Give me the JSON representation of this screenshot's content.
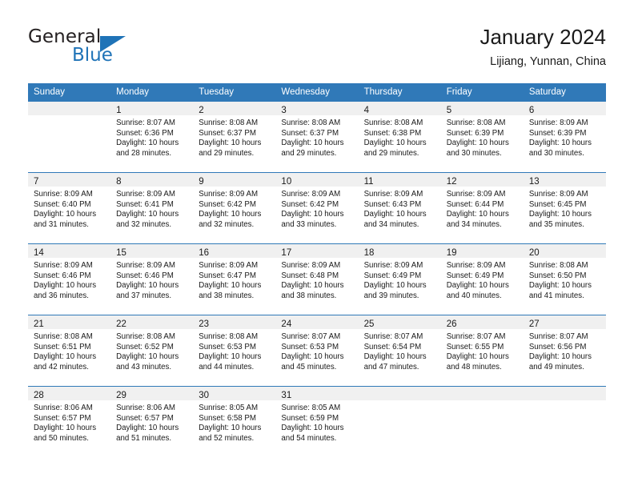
{
  "brand": {
    "name_part1": "General",
    "name_part2": "Blue",
    "accent_color": "#1f73b7"
  },
  "header": {
    "title": "January 2024",
    "subtitle": "Lijiang, Yunnan, China"
  },
  "theme": {
    "header_row_color": "#3079b8",
    "daynum_band_color": "#f0f0f0",
    "cell_background": "#ffffff",
    "separator_color": "#3079b8"
  },
  "weekday_headers": [
    "Sunday",
    "Monday",
    "Tuesday",
    "Wednesday",
    "Thursday",
    "Friday",
    "Saturday"
  ],
  "weeks": [
    [
      {
        "day": "",
        "sunrise": "",
        "sunset": "",
        "daylight1": "",
        "daylight2": ""
      },
      {
        "day": "1",
        "sunrise": "Sunrise: 8:07 AM",
        "sunset": "Sunset: 6:36 PM",
        "daylight1": "Daylight: 10 hours",
        "daylight2": "and 28 minutes."
      },
      {
        "day": "2",
        "sunrise": "Sunrise: 8:08 AM",
        "sunset": "Sunset: 6:37 PM",
        "daylight1": "Daylight: 10 hours",
        "daylight2": "and 29 minutes."
      },
      {
        "day": "3",
        "sunrise": "Sunrise: 8:08 AM",
        "sunset": "Sunset: 6:37 PM",
        "daylight1": "Daylight: 10 hours",
        "daylight2": "and 29 minutes."
      },
      {
        "day": "4",
        "sunrise": "Sunrise: 8:08 AM",
        "sunset": "Sunset: 6:38 PM",
        "daylight1": "Daylight: 10 hours",
        "daylight2": "and 29 minutes."
      },
      {
        "day": "5",
        "sunrise": "Sunrise: 8:08 AM",
        "sunset": "Sunset: 6:39 PM",
        "daylight1": "Daylight: 10 hours",
        "daylight2": "and 30 minutes."
      },
      {
        "day": "6",
        "sunrise": "Sunrise: 8:09 AM",
        "sunset": "Sunset: 6:39 PM",
        "daylight1": "Daylight: 10 hours",
        "daylight2": "and 30 minutes."
      }
    ],
    [
      {
        "day": "7",
        "sunrise": "Sunrise: 8:09 AM",
        "sunset": "Sunset: 6:40 PM",
        "daylight1": "Daylight: 10 hours",
        "daylight2": "and 31 minutes."
      },
      {
        "day": "8",
        "sunrise": "Sunrise: 8:09 AM",
        "sunset": "Sunset: 6:41 PM",
        "daylight1": "Daylight: 10 hours",
        "daylight2": "and 32 minutes."
      },
      {
        "day": "9",
        "sunrise": "Sunrise: 8:09 AM",
        "sunset": "Sunset: 6:42 PM",
        "daylight1": "Daylight: 10 hours",
        "daylight2": "and 32 minutes."
      },
      {
        "day": "10",
        "sunrise": "Sunrise: 8:09 AM",
        "sunset": "Sunset: 6:42 PM",
        "daylight1": "Daylight: 10 hours",
        "daylight2": "and 33 minutes."
      },
      {
        "day": "11",
        "sunrise": "Sunrise: 8:09 AM",
        "sunset": "Sunset: 6:43 PM",
        "daylight1": "Daylight: 10 hours",
        "daylight2": "and 34 minutes."
      },
      {
        "day": "12",
        "sunrise": "Sunrise: 8:09 AM",
        "sunset": "Sunset: 6:44 PM",
        "daylight1": "Daylight: 10 hours",
        "daylight2": "and 34 minutes."
      },
      {
        "day": "13",
        "sunrise": "Sunrise: 8:09 AM",
        "sunset": "Sunset: 6:45 PM",
        "daylight1": "Daylight: 10 hours",
        "daylight2": "and 35 minutes."
      }
    ],
    [
      {
        "day": "14",
        "sunrise": "Sunrise: 8:09 AM",
        "sunset": "Sunset: 6:46 PM",
        "daylight1": "Daylight: 10 hours",
        "daylight2": "and 36 minutes."
      },
      {
        "day": "15",
        "sunrise": "Sunrise: 8:09 AM",
        "sunset": "Sunset: 6:46 PM",
        "daylight1": "Daylight: 10 hours",
        "daylight2": "and 37 minutes."
      },
      {
        "day": "16",
        "sunrise": "Sunrise: 8:09 AM",
        "sunset": "Sunset: 6:47 PM",
        "daylight1": "Daylight: 10 hours",
        "daylight2": "and 38 minutes."
      },
      {
        "day": "17",
        "sunrise": "Sunrise: 8:09 AM",
        "sunset": "Sunset: 6:48 PM",
        "daylight1": "Daylight: 10 hours",
        "daylight2": "and 38 minutes."
      },
      {
        "day": "18",
        "sunrise": "Sunrise: 8:09 AM",
        "sunset": "Sunset: 6:49 PM",
        "daylight1": "Daylight: 10 hours",
        "daylight2": "and 39 minutes."
      },
      {
        "day": "19",
        "sunrise": "Sunrise: 8:09 AM",
        "sunset": "Sunset: 6:49 PM",
        "daylight1": "Daylight: 10 hours",
        "daylight2": "and 40 minutes."
      },
      {
        "day": "20",
        "sunrise": "Sunrise: 8:08 AM",
        "sunset": "Sunset: 6:50 PM",
        "daylight1": "Daylight: 10 hours",
        "daylight2": "and 41 minutes."
      }
    ],
    [
      {
        "day": "21",
        "sunrise": "Sunrise: 8:08 AM",
        "sunset": "Sunset: 6:51 PM",
        "daylight1": "Daylight: 10 hours",
        "daylight2": "and 42 minutes."
      },
      {
        "day": "22",
        "sunrise": "Sunrise: 8:08 AM",
        "sunset": "Sunset: 6:52 PM",
        "daylight1": "Daylight: 10 hours",
        "daylight2": "and 43 minutes."
      },
      {
        "day": "23",
        "sunrise": "Sunrise: 8:08 AM",
        "sunset": "Sunset: 6:53 PM",
        "daylight1": "Daylight: 10 hours",
        "daylight2": "and 44 minutes."
      },
      {
        "day": "24",
        "sunrise": "Sunrise: 8:07 AM",
        "sunset": "Sunset: 6:53 PM",
        "daylight1": "Daylight: 10 hours",
        "daylight2": "and 45 minutes."
      },
      {
        "day": "25",
        "sunrise": "Sunrise: 8:07 AM",
        "sunset": "Sunset: 6:54 PM",
        "daylight1": "Daylight: 10 hours",
        "daylight2": "and 47 minutes."
      },
      {
        "day": "26",
        "sunrise": "Sunrise: 8:07 AM",
        "sunset": "Sunset: 6:55 PM",
        "daylight1": "Daylight: 10 hours",
        "daylight2": "and 48 minutes."
      },
      {
        "day": "27",
        "sunrise": "Sunrise: 8:07 AM",
        "sunset": "Sunset: 6:56 PM",
        "daylight1": "Daylight: 10 hours",
        "daylight2": "and 49 minutes."
      }
    ],
    [
      {
        "day": "28",
        "sunrise": "Sunrise: 8:06 AM",
        "sunset": "Sunset: 6:57 PM",
        "daylight1": "Daylight: 10 hours",
        "daylight2": "and 50 minutes."
      },
      {
        "day": "29",
        "sunrise": "Sunrise: 8:06 AM",
        "sunset": "Sunset: 6:57 PM",
        "daylight1": "Daylight: 10 hours",
        "daylight2": "and 51 minutes."
      },
      {
        "day": "30",
        "sunrise": "Sunrise: 8:05 AM",
        "sunset": "Sunset: 6:58 PM",
        "daylight1": "Daylight: 10 hours",
        "daylight2": "and 52 minutes."
      },
      {
        "day": "31",
        "sunrise": "Sunrise: 8:05 AM",
        "sunset": "Sunset: 6:59 PM",
        "daylight1": "Daylight: 10 hours",
        "daylight2": "and 54 minutes."
      },
      {
        "day": "",
        "sunrise": "",
        "sunset": "",
        "daylight1": "",
        "daylight2": ""
      },
      {
        "day": "",
        "sunrise": "",
        "sunset": "",
        "daylight1": "",
        "daylight2": ""
      },
      {
        "day": "",
        "sunrise": "",
        "sunset": "",
        "daylight1": "",
        "daylight2": ""
      }
    ]
  ]
}
